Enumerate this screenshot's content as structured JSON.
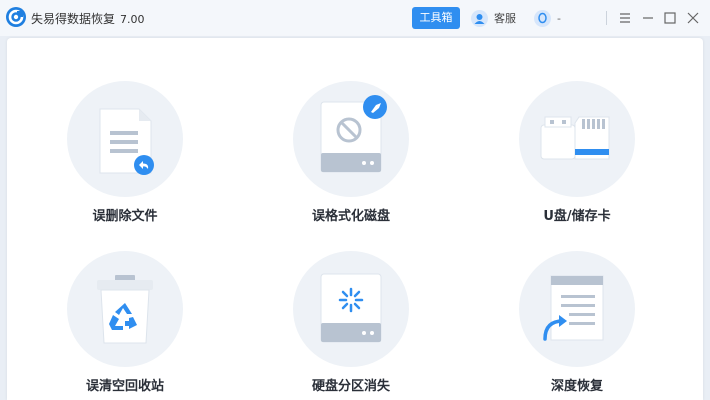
{
  "titlebar": {
    "app_name": "失易得数据恢复",
    "version": "7.00",
    "toolbox_label": "工具箱",
    "service_label": "客服",
    "qq_label": "-"
  },
  "tiles": [
    {
      "label": "误删除文件",
      "icon": "deleted-file-icon"
    },
    {
      "label": "误格式化磁盘",
      "icon": "format-disk-icon"
    },
    {
      "label": "U盘/储存卡",
      "icon": "usb-sd-card-icon"
    },
    {
      "label": "误清空回收站",
      "icon": "recycle-bin-icon"
    },
    {
      "label": "硬盘分区消失",
      "icon": "lost-partition-icon"
    },
    {
      "label": "深度恢复",
      "icon": "deep-recovery-icon"
    }
  ],
  "colors": {
    "accent": "#2f8ef0",
    "icon_gray": "#b8c3d1",
    "tile_bg": "#eef2f7"
  }
}
